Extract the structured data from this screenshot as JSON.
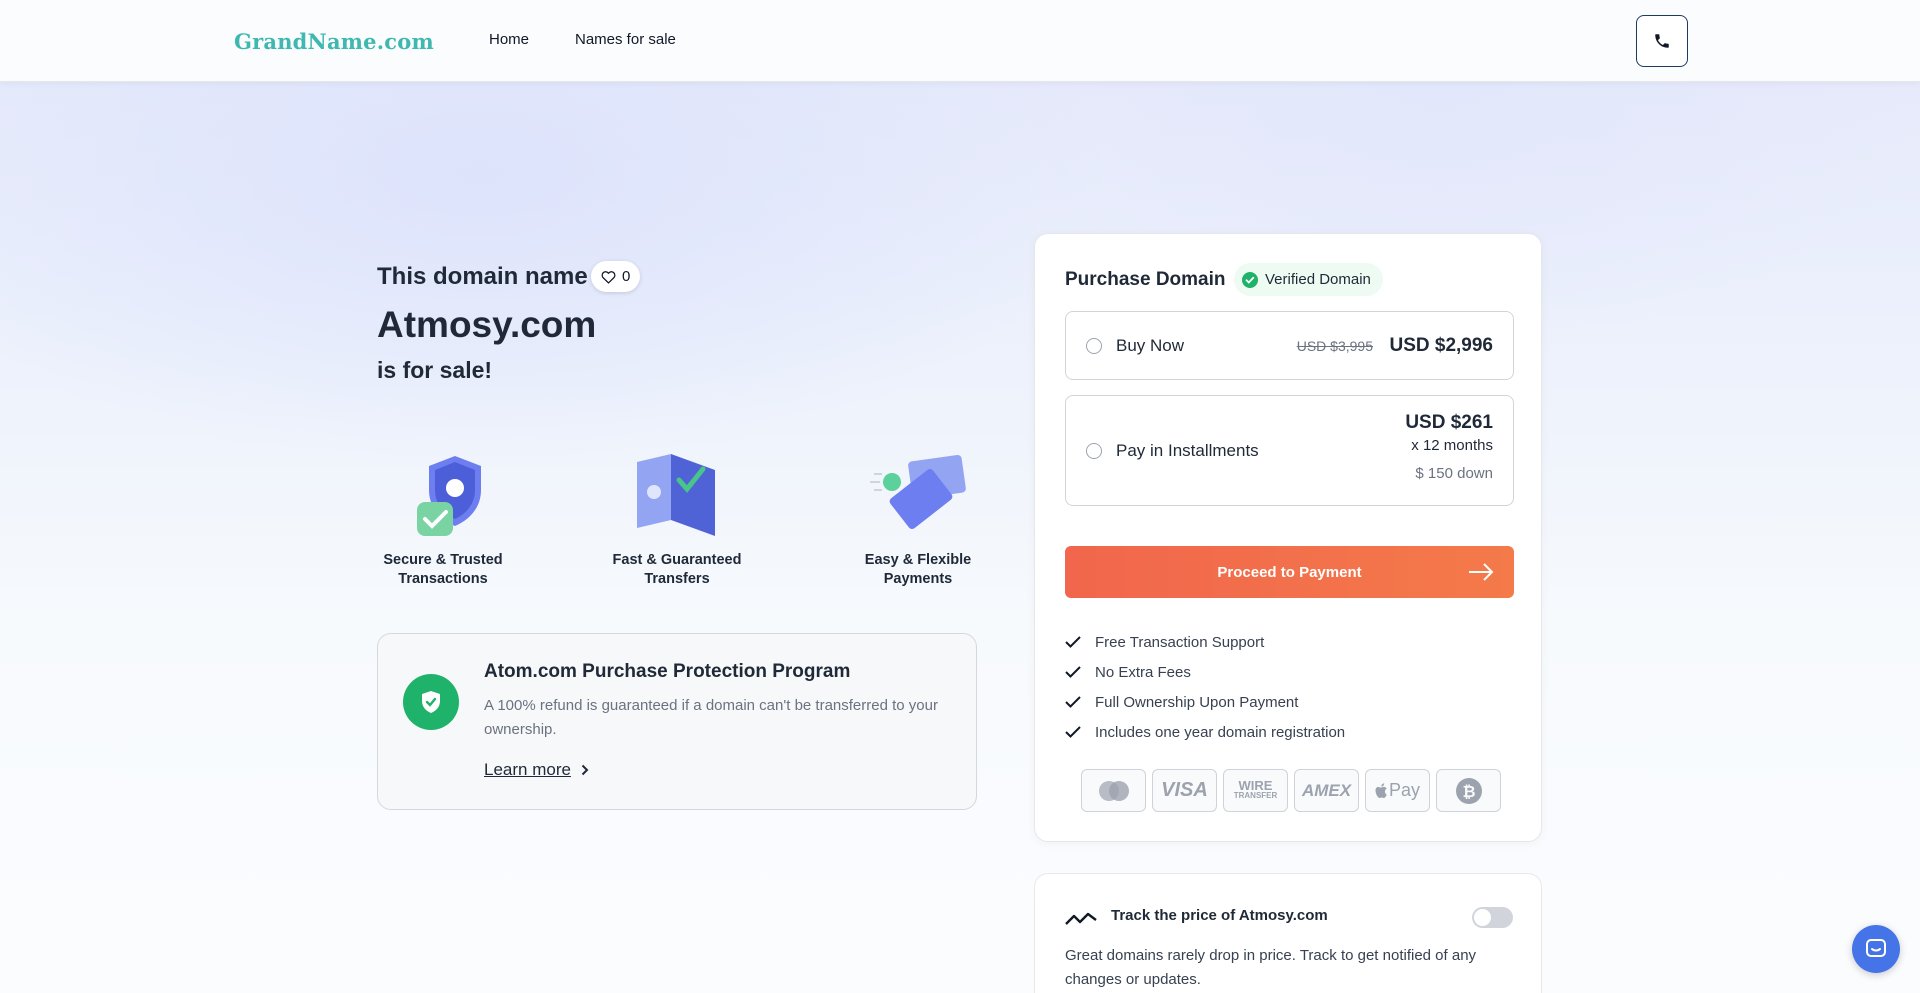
{
  "header": {
    "logo": "GrandName.com",
    "nav": [
      "Home",
      "Names for sale"
    ]
  },
  "hero": {
    "lead": "This domain name",
    "likes": "0",
    "domain": "Atmosy.com",
    "tagline": "is for sale!"
  },
  "features": [
    {
      "caption": "Secure & Trusted Transactions"
    },
    {
      "caption": "Fast & Guaranteed Transfers"
    },
    {
      "caption": "Easy & Flexible Payments"
    }
  ],
  "protection": {
    "title": "Atom.com Purchase Protection Program",
    "description": "A 100% refund is guaranteed if a domain can't be transferred to your ownership.",
    "link": "Learn more"
  },
  "purchase": {
    "title": "Purchase Domain",
    "badge": "Verified Domain",
    "buy_now": {
      "label": "Buy Now",
      "old_price": "USD $3,995",
      "price": "USD $2,996"
    },
    "installments": {
      "label": "Pay in Installments",
      "price": "USD $261",
      "months": "x 12 months",
      "down": "$ 150 down"
    },
    "cta": "Proceed to Payment",
    "bullets": [
      "Free Transaction Support",
      "No Extra Fees",
      "Full Ownership Upon Payment",
      "Includes one year domain registration"
    ],
    "payment_methods": [
      "mastercard-icon",
      "visa-icon",
      "wire-transfer-icon",
      "amex-icon",
      "apple-pay-icon",
      "bitcoin-icon"
    ],
    "payment_labels": {
      "visa": "VISA",
      "wire": "WIRE",
      "transfer": "TRANSFER",
      "amex": "AMEX",
      "applepay": "Pay"
    }
  },
  "track": {
    "title": "Track the price of Atmosy.com",
    "description": "Great domains rarely drop in price. Track to get notified of any changes or updates."
  },
  "colors": {
    "logo": "#3fb8b0",
    "cta": "#f1664c",
    "verified": "#1fb26b",
    "chat": "#4573e8"
  }
}
